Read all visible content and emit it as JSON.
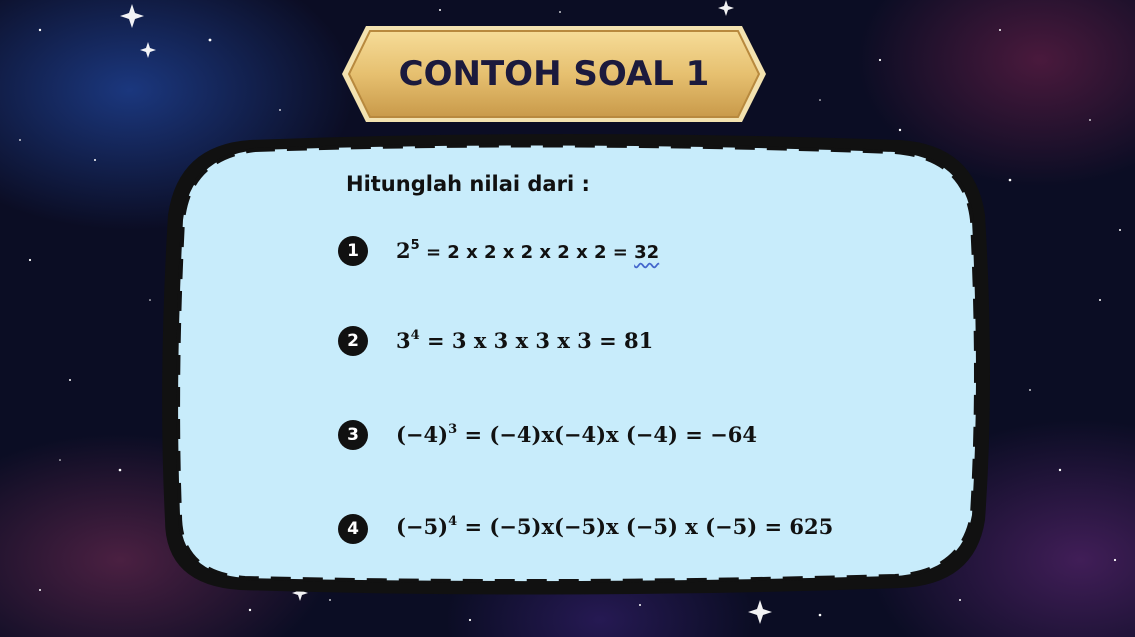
{
  "title": "CONTOH SOAL 1",
  "intro": "Hitunglah nilai dari :",
  "items": [
    {
      "number": "1",
      "base": "2",
      "exponent": "5",
      "expansion": "= 2 x 2 x 2 x 2 x 2 =",
      "result": "32"
    },
    {
      "number": "2",
      "base": "3",
      "exponent": "4",
      "expansion": "= 3 x 3 x 3 x 3 = 81"
    },
    {
      "number": "3",
      "base": "(−4)",
      "exponent": "3",
      "expansion": "= (−4)x(−4)x (−4) =  −64"
    },
    {
      "number": "4",
      "base": "(−5)",
      "exponent": "4",
      "expansion": "= (−5)x(−5)x (−5) x (−5) =  625"
    }
  ],
  "colors": {
    "panel_fill": "#c8ecfb",
    "panel_border": "#111111",
    "badge_gold": "#e9c77c",
    "title_text": "#1b1a3d",
    "background": "#0b0d24"
  }
}
